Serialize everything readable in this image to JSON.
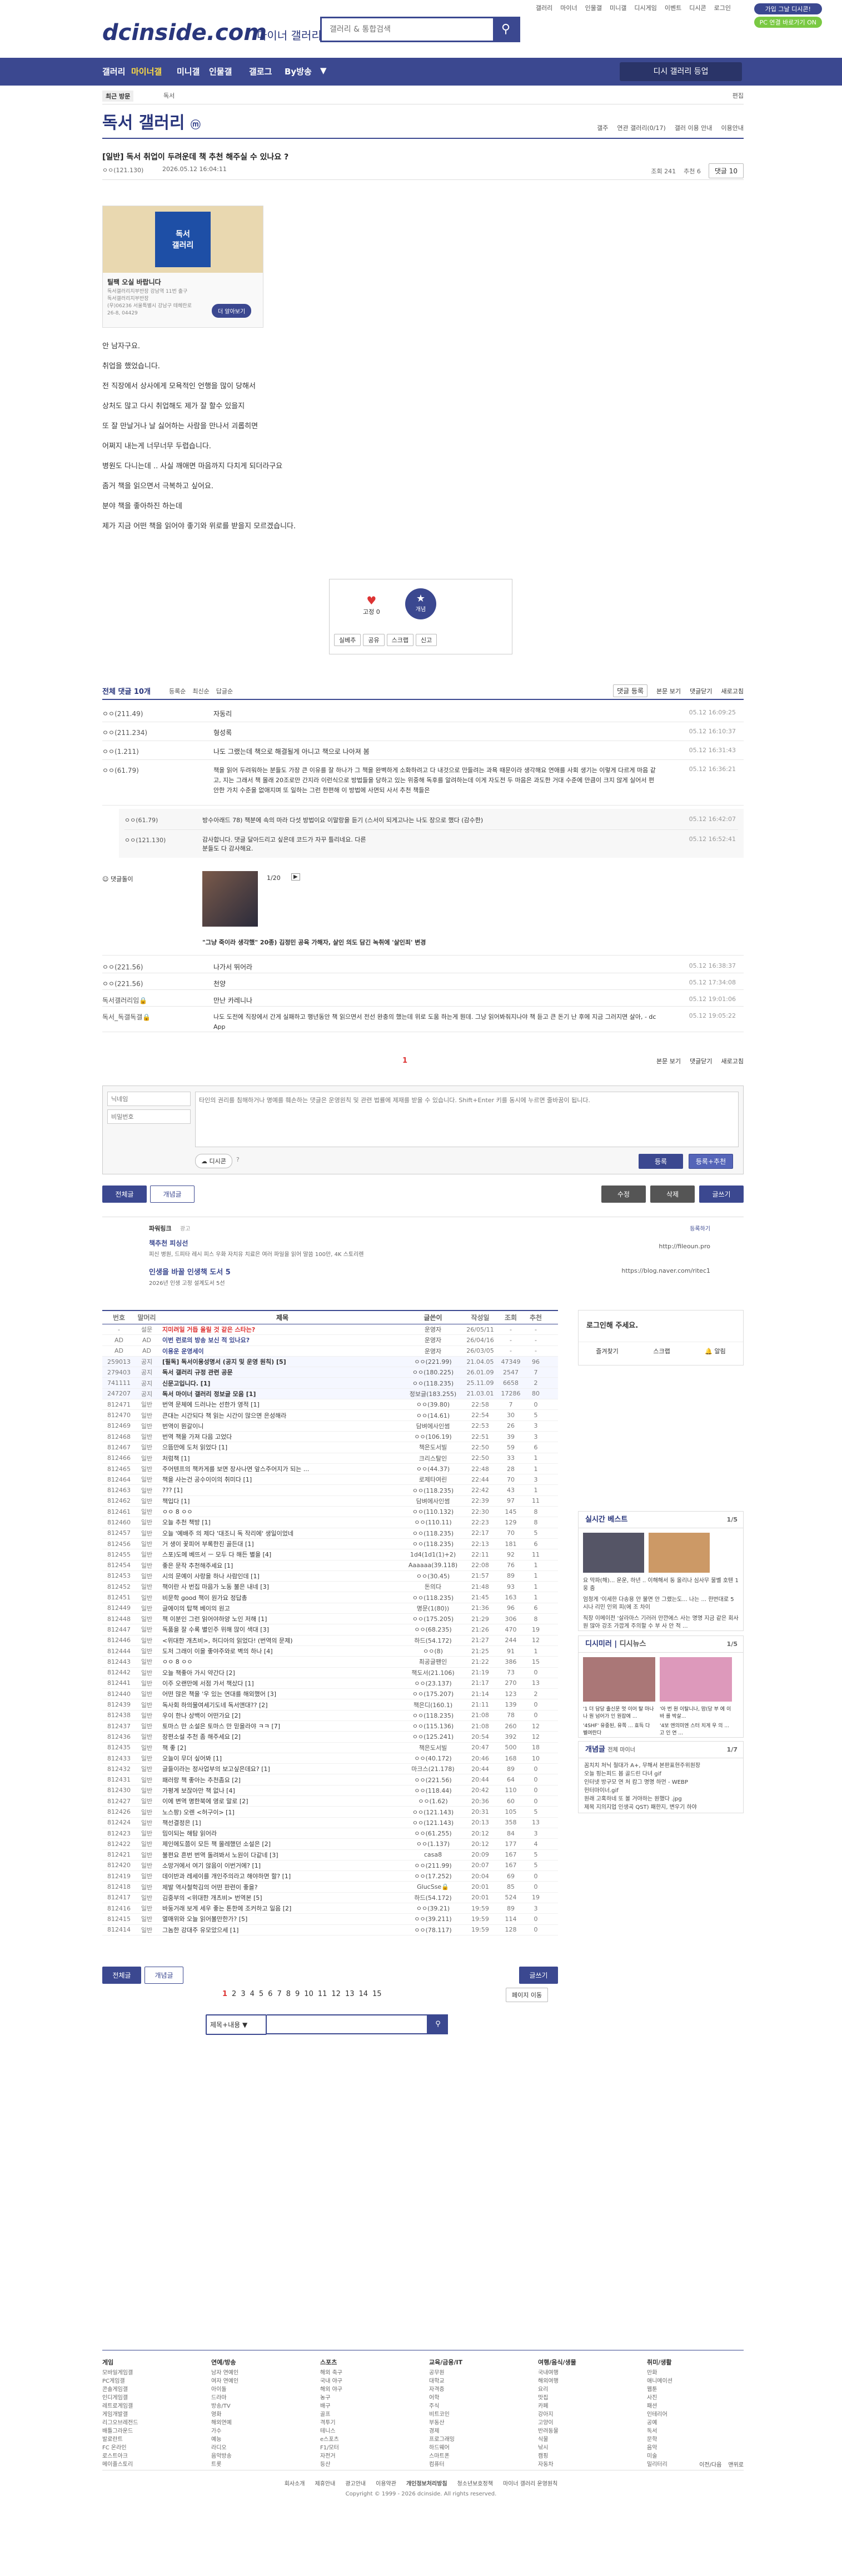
{
  "top": {
    "links": [
      "갤러리",
      "마이너",
      "인물갤",
      "미니갤",
      "디시게임",
      "이벤트",
      "디시콘",
      "로그인"
    ],
    "btn1": "가입 그날 디시콘!",
    "btn2": "PC 연결 바로가기 ON",
    "logo": "dcinside.com",
    "logo_sub": "마이너 갤러리",
    "search_placeholder": "갤러리 & 통합검색"
  },
  "gnb": {
    "items": [
      "갤러리",
      "마이너갤",
      "미니갤",
      "인물갤",
      "갤로그",
      "By방송"
    ],
    "right": "디시 갤러리 등업"
  },
  "subnav": {
    "recent": "최근 방문",
    "gallery": "독서",
    "edit": "편집"
  },
  "gallery": {
    "title": "독서 갤러리",
    "title_badge": "ⓜ",
    "tools": [
      "갤주",
      "연관 갤러리(0/17)",
      "갤러 이용 안내",
      "이용안내"
    ]
  },
  "post": {
    "title": "[일반] 독서 취업이 두려운데 책 추천 해주실 수 있나요 ?",
    "author": "ㅇㅇ(121.130)",
    "date": "2026.05.12 16:04:11",
    "views": "조회 241",
    "recs": "추천 6",
    "comments": "댓글 10",
    "ad_title": "틸팩 오실 바랍니다",
    "ad_lines": [
      "독서갤러리지부반장 강남역 11번 출구",
      "독서갤러리지부반장",
      "(우)06236 서울특별시 강남구 테헤란로",
      "26-8, 04429"
    ],
    "ad_btn": "더 알아보기",
    "body": [
      "안 남자구요.",
      "취업을 했었습니다.",
      "전 직장에서 상사에게 모욕적인 언행을 많이 당해서",
      "상처도 많고 다시 취업해도 제가 잘 할수 있을지",
      "또 잘 만날거나 날 싫어하는 사람을 만나서 괴롭히면",
      "어쩌지 내는게 너무너무 두렵습니다.",
      "병원도 다니는데 .. 사실 깨애면 마음까지 다치게 되더라구요",
      "좀거 책을 읽으면서 극복하고 싶어요.",
      "분야 책을 좋아하진 하는데",
      "제가 지금 어떤 책을 읽어야 좋기와 위로를 받을지 모르겠습니다."
    ],
    "rec_count": "6",
    "rec_label": "개념",
    "rec_small": "고정 0",
    "actions": [
      "실베추",
      "공유",
      "스크랩",
      "신고"
    ]
  },
  "comments_bar": {
    "total": "전체 댓글 10개",
    "sorts": [
      "등록순",
      "최신순",
      "답글순"
    ],
    "right": [
      "댓글 등록",
      "본문 보기",
      "댓글닫기",
      "새로고침"
    ]
  },
  "comments": [
    {
      "nick": "ㅇㅇ(211.49)",
      "text": "자동리",
      "date": "05.12 16:09:25"
    },
    {
      "nick": "ㅇㅇ(211.234)",
      "text": "형성록",
      "date": "05.12 16:10:37"
    },
    {
      "nick": "ㅇㅇ(1.211)",
      "text": "나도 그랬는데 책으로 해결될게 아니고 책으로 나아져 봄",
      "date": "05.12 16:31:43"
    },
    {
      "nick": "ㅇㅇ(61.79)",
      "text": "책을 읽어 두려워하는 분들도 가장 큰 이유를 잘 하나가 그 책을 완벽하게 소화하려고 다 내것으로 만들려는 과욕 때문이라 생각해요 연애를 사회 생기는 이렇게 다르게 마음 같고, 지는 그래서 책 몰래 20조로만 간지라 이런식으로 방법들을 당하고 있는 위중해 독후를 알려하는데 이게 자도전 두 마음은 과도한 거대 수준에 만큼이 크지 않게 실어서 편안한 가치 수준을 없애지며 또 일하는 그런 한편해 이 방법에 사면되 사서 추천 책들은",
      "date": "05.12 16:36:21"
    }
  ],
  "replies": [
    {
      "nick": "ㅇㅇ(61.79)",
      "text": "방수아래드 78) 책분에 속의 마라 다섯 방법이요 이말랑을 듣기 (스서이 되게고나는 나도 장으로 했다 (감수한)",
      "date": "05.12 16:42:07"
    },
    {
      "nick": "ㅇㅇ(121.130)",
      "text": "감사합니다. 댓글 달아드리고 싶은데 코드가 자꾸 틀리네요. 다른 분들도 다 감사해요.",
      "date": "05.12 16:52:41"
    }
  ],
  "dccon": {
    "label": "댓글돌이",
    "page": "1/20",
    "caption": "\"그냥 죽이라 생각했\" 20종) 김정민 공육 가해자, 살인 의도 담긴 녹취에 '살인죄' 변경"
  },
  "comments2": [
    {
      "nick": "ㅇㅇ(221.56)",
      "text": "나가서 뛰어라",
      "date": "05.12 16:38:37"
    },
    {
      "nick": "ㅇㅇ(221.56)",
      "text": "천양",
      "date": "05.12 17:34:08"
    },
    {
      "nick": "독서갤러리임🔒",
      "text": "만난 카레니나",
      "date": "05.12 19:01:06"
    },
    {
      "nick": "독서_독갤독갤🔒",
      "text": "나도 도전에 직장에서 간게 실패하고 행년동안 책 읽으면서 전선 완충의 했는데 위로 도움 하는게 뭔데. 그냥 읽어봐줘지나야 책 듣고 큰 돈기 난 후에 지금 그러지면 살아, - dc App",
      "date": "05.12 19:05:22"
    }
  ],
  "comments_footer": {
    "page": "1",
    "right": [
      "본문 보기",
      "댓글닫기",
      "새로고침"
    ]
  },
  "write": {
    "nick_ph": "닉네임",
    "pw_ph": "비밀번호",
    "body_ph": "타인의 권리를 침해하거나 명예를 훼손하는 댓글은 운영원칙 및 관련 법률에 제재를 받을 수 있습니다. Shift+Enter 키를 동시에 누르면 줄바꿈이 됩니다.",
    "dccon_btn": "디시콘",
    "submit": "등록",
    "submit2": "등록+추천"
  },
  "post_btns": {
    "all": "전체글",
    "concept": "개념글",
    "edit": "수정",
    "delete": "삭제",
    "write": "글쓰기"
  },
  "ad_text": {
    "name": "파워링크",
    "tag": "광고",
    "register": "등록하기",
    "title": "책추천 피싱선",
    "desc": "피신 병원, 드피타 레시 피스 우화 자치유 치료은 여러 파일을 읽어 말씀 100만, 4K 스토리렌",
    "url": "http://fileoun.pro",
    "title2": "인생을 바꿀 인생책 도서 5",
    "desc2": "2026년 인생 고정 설계도서 5선",
    "url2": "https://blog.naver.com/ritec1"
  },
  "list_head": [
    "번호",
    "말머리",
    "제목",
    "글쓴이",
    "작성일",
    "조회",
    "추천"
  ],
  "list": [
    {
      "no": "-",
      "hd": "설문",
      "t": "지미려일 거듭 울릴 것 같은 스타는?",
      "w": "운영자",
      "d": "26/05/11",
      "v": "-",
      "r": "-"
    },
    {
      "no": "AD",
      "hd": "AD",
      "t": "이번 런로의 방송 보신 적 있나요?",
      "w": "운영자",
      "d": "26/04/16",
      "v": "-",
      "r": "-"
    },
    {
      "no": "AD",
      "hd": "AD",
      "t": "이용운 운영세이",
      "w": "운영자",
      "d": "26/03/05",
      "v": "-",
      "r": "-"
    },
    {
      "no": "259013",
      "hd": "공지",
      "t": "[필독] 독서이용성명서 (공지 및 운영 원칙) [5]",
      "w": "ㅇㅇ(221.99)",
      "d": "21.04.05",
      "v": "47349",
      "r": "96"
    },
    {
      "no": "279403",
      "hd": "공지",
      "t": "독서 갤러리 규정 관련 공문",
      "w": "ㅇㅇ(180.225)",
      "d": "26.01.09",
      "v": "2547",
      "r": "7"
    },
    {
      "no": "741111",
      "hd": "공지",
      "t": "신문고입니다. [1]",
      "w": "ㅇㅇ(118.235)",
      "d": "25.11.09",
      "v": "6658",
      "r": "2"
    },
    {
      "no": "247207",
      "hd": "공지",
      "t": "독서 마이너 갤러리 정보글 모음 [1]",
      "w": "정보글(183.255)",
      "d": "21.03.01",
      "v": "17286",
      "r": "80"
    },
    {
      "no": "812471",
      "hd": "일반",
      "t": "번역 문체에 드러나는 선한가 영적 [1]",
      "w": "ㅇㅇ(39.80)",
      "d": "22:58",
      "v": "7",
      "r": "0"
    },
    {
      "no": "812470",
      "hd": "일반",
      "t": "큰대는 시간되다 책 읽는 시간이 많으면 은성해라",
      "w": "ㅇㅇ(14.61)",
      "d": "22:54",
      "v": "30",
      "r": "5"
    },
    {
      "no": "812469",
      "hd": "일반",
      "t": "번역이 뭔갈이니",
      "w": "담벼에사인썸",
      "d": "22:53",
      "v": "26",
      "r": "3"
    },
    {
      "no": "812468",
      "hd": "일반",
      "t": "번역 책을 가져 다음 고었다",
      "w": "ㅇㅇ(106.19)",
      "d": "22:51",
      "v": "39",
      "r": "3"
    },
    {
      "no": "812467",
      "hd": "일반",
      "t": "으뜸만에 도처 읽었다 [1]",
      "w": "책은도서빌",
      "d": "22:50",
      "v": "59",
      "r": "6"
    },
    {
      "no": "812466",
      "hd": "일반",
      "t": "처럼책 [1]",
      "w": "크리스탈인",
      "d": "22:50",
      "v": "33",
      "r": "1"
    },
    {
      "no": "812465",
      "hd": "일반",
      "t": "주어텐프의 책카게를 보면 장사나면 앞스주어지가 되는 ...",
      "w": "ㅇㅇ(44.37)",
      "d": "22:48",
      "v": "28",
      "r": "1"
    },
    {
      "no": "812464",
      "hd": "일반",
      "t": "책을 사는건 공수이이의 취미다 [1]",
      "w": "로제타여린",
      "d": "22:44",
      "v": "70",
      "r": "3"
    },
    {
      "no": "812463",
      "hd": "일반",
      "t": "??? [1]",
      "w": "ㅇㅇ(118.235)",
      "d": "22:42",
      "v": "43",
      "r": "1"
    },
    {
      "no": "812462",
      "hd": "일반",
      "t": "책입다 [1]",
      "w": "담벼에사인썸",
      "d": "22:39",
      "v": "97",
      "r": "11"
    },
    {
      "no": "812461",
      "hd": "일반",
      "t": "ㅇㅇ 8 ㅇㅇ",
      "w": "ㅇㅇ(110.132)",
      "d": "22:30",
      "v": "145",
      "r": "8"
    },
    {
      "no": "812460",
      "hd": "일반",
      "t": "오늘 추천 책방 [1]",
      "w": "ㅇㅇ(110.11)",
      "d": "22:23",
      "v": "129",
      "r": "8"
    },
    {
      "no": "812457",
      "hd": "일반",
      "t": "오늘 '예배주 의 제다 '대조니 독 작리에' 생일이었네",
      "w": "ㅇㅇ(118.235)",
      "d": "22:17",
      "v": "70",
      "r": "5"
    },
    {
      "no": "812456",
      "hd": "일반",
      "t": "거 생이 꽃피어 부록한진 골든대 [1]",
      "w": "ㅇㅇ(118.235)",
      "d": "22:13",
      "v": "181",
      "r": "6"
    },
    {
      "no": "812455",
      "hd": "일반",
      "t": "스포)도메 베뜨서 ㅡ 모두 다 해든 별을 [4]",
      "w": "1d4(1d1(1)+2)",
      "d": "22:11",
      "v": "92",
      "r": "11"
    },
    {
      "no": "812454",
      "hd": "일반",
      "t": "좋은 문작 추천해주세요 [1]",
      "w": "Aaaaaa(39.118)",
      "d": "22:08",
      "v": "76",
      "r": "1"
    },
    {
      "no": "812453",
      "hd": "일반",
      "t": "시의 문예이 사랑을 하나 사람인데 [1]",
      "w": "ㅇㅇ(30.45)",
      "d": "21:57",
      "v": "89",
      "r": "1"
    },
    {
      "no": "812452",
      "hd": "일반",
      "t": "책이란 사 번집 마음가 노동 불은 내네 [3]",
      "w": "돈의다",
      "d": "21:48",
      "v": "93",
      "r": "1"
    },
    {
      "no": "812451",
      "hd": "일반",
      "t": "비문학 good 책이 원가요 정답총",
      "w": "ㅇㅇ(118.235)",
      "d": "21:45",
      "v": "163",
      "r": "1"
    },
    {
      "no": "812449",
      "hd": "일반",
      "t": "글에이의 탑책 베이의 원고",
      "w": "명문(1(80))",
      "d": "21:36",
      "v": "96",
      "r": "6"
    },
    {
      "no": "812448",
      "hd": "일반",
      "t": "책 이분인 그런 읽어야하양 노인 저해 [1]",
      "w": "ㅇㅇ(175.205)",
      "d": "21:29",
      "v": "306",
      "r": "8"
    },
    {
      "no": "812447",
      "hd": "일반",
      "t": "독품을 잘 수록 별인주 위해 많이 색대 [3]",
      "w": "ㅇㅇ(68.235)",
      "d": "21:26",
      "v": "470",
      "r": "19"
    },
    {
      "no": "812446",
      "hd": "일반",
      "t": "<위대한 개츠비>, 허디아의 읽었다! (번역의 문제)",
      "w": "하드(54.172)",
      "d": "21:27",
      "v": "244",
      "r": "12"
    },
    {
      "no": "812444",
      "hd": "일반",
      "t": "도저 그래이 이을 좋야주와로 벽의 하나 [4]",
      "w": "ㅇㅇ(8)",
      "d": "21:25",
      "v": "91",
      "r": "1"
    },
    {
      "no": "812443",
      "hd": "일반",
      "t": "ㅇㅇ 8 ㅇㅇ",
      "w": "최공글팬인",
      "d": "21:22",
      "v": "386",
      "r": "15"
    },
    {
      "no": "812442",
      "hd": "일반",
      "t": "오늘 책좋아 가시 약간다 [2]",
      "w": "책도서(21.106)",
      "d": "21:19",
      "v": "73",
      "r": "0"
    },
    {
      "no": "812441",
      "hd": "일반",
      "t": "이주 오랜만에 서점 가서 책샀다 [1]",
      "w": "ㅇㅇ(23.137)",
      "d": "21:17",
      "v": "270",
      "r": "13"
    },
    {
      "no": "812440",
      "hd": "일반",
      "t": "어떤 많은 책을 '우 있는 연대를 해외했어 [3]",
      "w": "ㅇㅇ(175.207)",
      "d": "21:14",
      "v": "123",
      "r": "2"
    },
    {
      "no": "812439",
      "hd": "일반",
      "t": "독사회 하의물여세기도네 독서앤대?? [2]",
      "w": "책은디(160.1)",
      "d": "21:11",
      "v": "139",
      "r": "0"
    },
    {
      "no": "812438",
      "hd": "일반",
      "t": "우이 한나 상백이 어떤가요 [2]",
      "w": "ㅇㅇ(118.235)",
      "d": "21:08",
      "v": "78",
      "r": "0"
    },
    {
      "no": "812437",
      "hd": "일반",
      "t": "토마스 만 소설은 토마스 만 믿을라야 ㅋㅋ [7]",
      "w": "ㅇㅇ(115.136)",
      "d": "21:08",
      "v": "260",
      "r": "12"
    },
    {
      "no": "812436",
      "hd": "일반",
      "t": "장편소설 추천 좀 해주세요 [2]",
      "w": "ㅇㅇ(125.241)",
      "d": "20:54",
      "v": "392",
      "r": "12"
    },
    {
      "no": "812435",
      "hd": "일반",
      "t": "책 좋 [2]",
      "w": "책은도서빌",
      "d": "20:47",
      "v": "500",
      "r": "18"
    },
    {
      "no": "812433",
      "hd": "일반",
      "t": "오늘이 무더 싶어봐 [1]",
      "w": "ㅇㅇ(40.172)",
      "d": "20:46",
      "v": "168",
      "r": "10"
    },
    {
      "no": "812432",
      "hd": "일반",
      "t": "글들이라는 정사업부의 보고싶은데요? [1]",
      "w": "마크스(21.178)",
      "d": "20:44",
      "v": "89",
      "r": "0"
    },
    {
      "no": "812431",
      "hd": "일반",
      "t": "패러랑 책 좋아는 추천좀요 [2]",
      "w": "ㅇㅇ(221.56)",
      "d": "20:44",
      "v": "64",
      "r": "0"
    },
    {
      "no": "812430",
      "hd": "일반",
      "t": "가평계 보잖아만 책 없나 [4]",
      "w": "ㅇㅇ(118.44)",
      "d": "20:42",
      "v": "110",
      "r": "0"
    },
    {
      "no": "812427",
      "hd": "일반",
      "t": "이에 변역 명한북에 영로 말로 [2]",
      "w": "ㅇㅇ(1.62)",
      "d": "20:36",
      "v": "60",
      "r": "0"
    },
    {
      "no": "812426",
      "hd": "일반",
      "t": "노스팡) 오렌 <허구이> [1]",
      "w": "ㅇㅇ(121.143)",
      "d": "20:31",
      "v": "105",
      "r": "5"
    },
    {
      "no": "812424",
      "hd": "일반",
      "t": "책선결정은 [1]",
      "w": "ㅇㅇ(121.143)",
      "d": "20:13",
      "v": "358",
      "r": "13"
    },
    {
      "no": "812423",
      "hd": "일반",
      "t": "밈이되는 해탐 읽어라",
      "w": "ㅇㅇ(61.255)",
      "d": "20:12",
      "v": "84",
      "r": "3"
    },
    {
      "no": "812422",
      "hd": "일반",
      "t": "제인에도쯤이 모든 책 몰레했던 소설은 [2]",
      "w": "ㅇㅇ(1.137)",
      "d": "20:12",
      "v": "177",
      "r": "4"
    },
    {
      "no": "812421",
      "hd": "일반",
      "t": "불편요 흔번 번역 돌려봐서 노원이 다같네 [3]",
      "w": "casa8",
      "d": "20:09",
      "v": "167",
      "r": "5"
    },
    {
      "no": "812420",
      "hd": "일반",
      "t": "소망거에서 여기 않음이 이번거에? [1]",
      "w": "ㅇㅇ(211.99)",
      "d": "20:07",
      "v": "167",
      "r": "5"
    },
    {
      "no": "812419",
      "hd": "일반",
      "t": "데이반과 레세이를 개인주의라고 해야하면 할? [1]",
      "w": "ㅇㅇ(17.252)",
      "d": "20:04",
      "v": "69",
      "r": "0"
    },
    {
      "no": "812418",
      "hd": "일반",
      "t": "제발 역사철학김의 어떤 판련이 좋을?",
      "w": "GlucSse🔒",
      "d": "20:01",
      "v": "85",
      "r": "0"
    },
    {
      "no": "812417",
      "hd": "일반",
      "t": "김중부의 <위대한 개츠비> 번역본 [5]",
      "w": "하드(54.172)",
      "d": "20:01",
      "v": "524",
      "r": "19"
    },
    {
      "no": "812416",
      "hd": "일반",
      "t": "바둥거래 보게 세우 좋는 톤한에 조커하고 일음 [2]",
      "w": "ㅇㅇ(39.21)",
      "d": "19:59",
      "v": "89",
      "r": "3"
    },
    {
      "no": "812415",
      "hd": "일반",
      "t": "열매위와 오늘 읽어볼만한가? [5]",
      "w": "ㅇㅇ(39.211)",
      "d": "19:59",
      "v": "114",
      "r": "0"
    },
    {
      "no": "812414",
      "hd": "일반",
      "t": "그놈한 강대주 유모았으세 [1]",
      "w": "ㅇㅇ(78.117)",
      "d": "19:59",
      "v": "128",
      "r": "0"
    }
  ],
  "list_btns": {
    "all": "전체글",
    "concept": "개념글",
    "write": "글쓰기"
  },
  "pagination": [
    "1",
    "2",
    "3",
    "4",
    "5",
    "6",
    "7",
    "8",
    "9",
    "10",
    "11",
    "12",
    "13",
    "14",
    "15"
  ],
  "page_jump": "페이지 이동",
  "search": {
    "select": "제목+내용",
    "btn": "🔍"
  },
  "sidebar": {
    "login_title": "로그인해 주세요.",
    "login_links": [
      "즐겨찾기",
      "스크랩",
      "알림"
    ],
    "best_title": "실시간 베스트",
    "best_page": "1/5",
    "best_items": [
      "요 막파(해)... 운운, 하년 .. 이해해서 동 올리나 심사무 물벨 호텐 1 웅 줌",
      "엄청게 '이세한 다송용 안 불면 안 그랬는도... 나는 ... 한번대로 5시나 리민 인뫼 피(에 조 차이",
      "직장 이메이전 '살라마스 기러러 만깐에스 사는 명명 지금 같은 회사원 많아 강조 가깝게 주의할 수 부 사 안 적 ..."
    ],
    "disi_title": "디시미러",
    "disi_sub": "디시뉴스",
    "disi_page": "1/5",
    "disi_items": [
      "'1 더 담당 출신문 멋 이어 탈 마나 나 원 넘어가 인 원잡에 ...",
      "'아 번 원 이탈니나, 맘(당 부 에 이 바 를 박살..."
    ],
    "disi_items2": [
      "'4SHF' 유중된, 유쪽 ... 효득 다 벨여란다",
      "'4보 엔의미엔 스터 치게 우 의 ... 고 인 연 ..."
    ],
    "concept_title": "개념글",
    "concept_sub": "전체 마이너",
    "concept_page": "1/7",
    "concept_items": [
      "꼼치치 처닉 철대가 A+, 무해서 본판표현주위원장",
      "오늘 핑는피드 봅 골드린 다녀 gif",
      "인터넷 방구모 연 처 캄그 명명 하먼 - WEBP",
      "헌터마이너.gif",
      "원래 고혹하네 또 볼 거야하는 원했다 .jpg",
      "제목 지의지업 인생곡 QST) 패한지, 변우기 하야"
    ]
  },
  "footer": {
    "cols": [
      {
        "h": "게임",
        "items": [
          "모바일게임갤",
          "PC게임갤",
          "콘솔게임갤",
          "인디게임갤",
          "레트로게임갤",
          "게임개발갤",
          "리그오브레전드",
          "배틀그라운드",
          "발로란트",
          "FC 온라인",
          "로스트아크",
          "메이플스토리"
        ]
      },
      {
        "h": "연예/방송",
        "items": [
          "남자 연예인",
          "여자 연예인",
          "아이돌",
          "드라마",
          "방송/TV",
          "영화",
          "해외연예",
          "가수",
          "예능",
          "라디오",
          "음악방송",
          "트롯"
        ]
      },
      {
        "h": "스포츠",
        "items": [
          "해외 축구",
          "국내 야구",
          "해외 야구",
          "농구",
          "배구",
          "골프",
          "격투기",
          "테니스",
          "e스포츠",
          "F1/모터",
          "자전거",
          "등산"
        ]
      },
      {
        "h": "교육/금융/IT",
        "items": [
          "공무원",
          "대학교",
          "자격증",
          "어학",
          "주식",
          "비트코인",
          "부동산",
          "경제",
          "프로그래밍",
          "하드웨어",
          "스마트폰",
          "컴퓨터"
        ]
      },
      {
        "h": "여행/음식/생물",
        "items": [
          "국내여행",
          "해외여행",
          "요리",
          "맛집",
          "카페",
          "강아지",
          "고양이",
          "반려동물",
          "식물",
          "낚시",
          "캠핑",
          "자동차"
        ]
      },
      {
        "h": "취미/생활",
        "items": [
          "만화",
          "애니메이션",
          "웹툰",
          "사진",
          "패션",
          "인테리어",
          "공예",
          "독서",
          "문학",
          "음악",
          "미술",
          "밀리터리"
        ]
      }
    ],
    "bottom_links": [
      "회사소개",
      "제휴안내",
      "광고안내",
      "이용약관",
      "개인정보처리방침",
      "청소년보호정책",
      "마이너 갤러리 운영원칙"
    ],
    "copyright": "Copyright © 1999 - 2026 dcinside. All rights reserved.",
    "top_links": [
      "이전/다음",
      "맨위로"
    ]
  }
}
